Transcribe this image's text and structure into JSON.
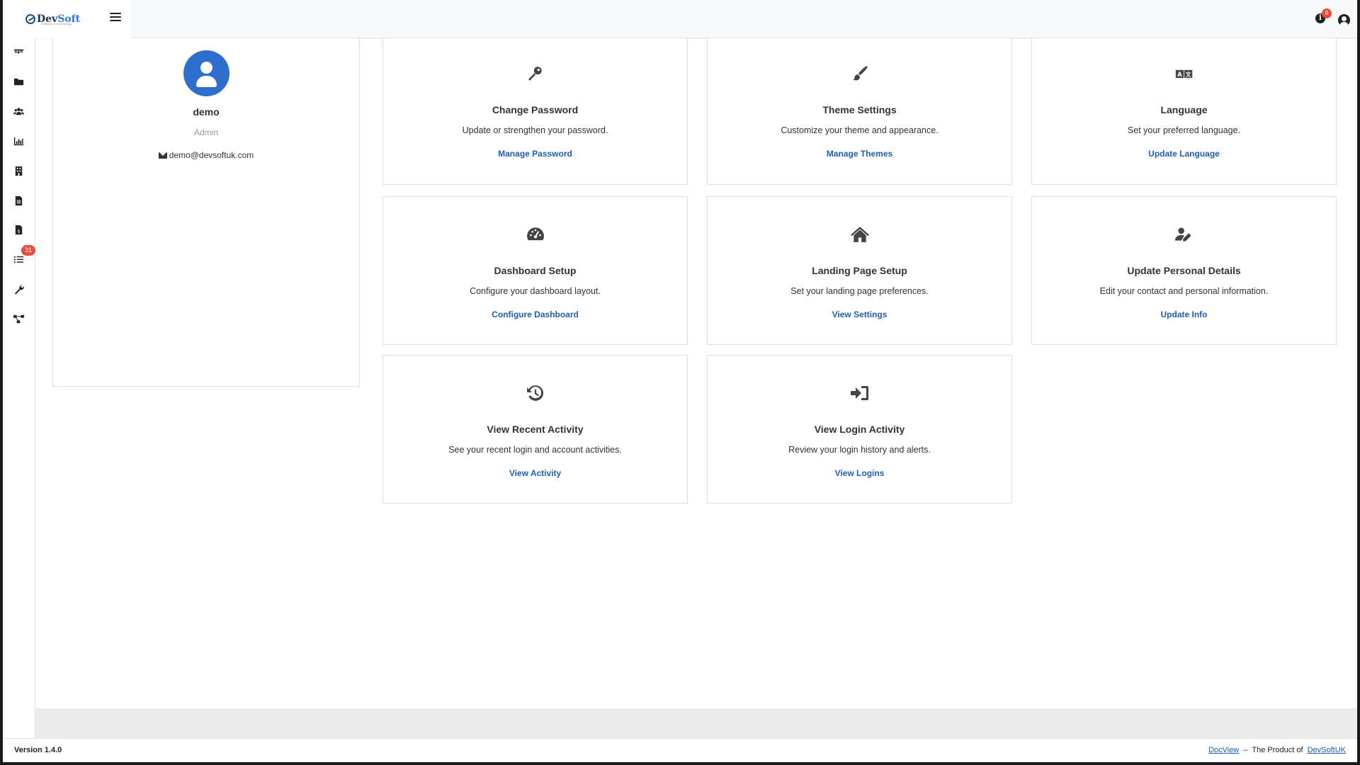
{
  "brand": {
    "name_part1": "Dev",
    "name_part2": "Soft",
    "tagline": "software & technology"
  },
  "header": {
    "notifications_badge": "8"
  },
  "sidebar": {
    "items": [
      {
        "icon": "dashboard-icon"
      },
      {
        "icon": "folder-icon"
      },
      {
        "icon": "users-icon"
      },
      {
        "icon": "chart-bar-icon"
      },
      {
        "icon": "building-icon"
      },
      {
        "icon": "document-icon"
      },
      {
        "icon": "invoice-icon"
      },
      {
        "icon": "task-list-icon",
        "badge": "31"
      },
      {
        "icon": "wrench-icon"
      },
      {
        "icon": "workflow-icon"
      }
    ]
  },
  "profile": {
    "name": "demo",
    "role": "Admin",
    "email": "demo@devsoftuk.com",
    "avatar_color": "#2d6fcc"
  },
  "cards": [
    {
      "icon": "key-icon",
      "title": "Change Password",
      "description": "Update or strengthen your password.",
      "link": "Manage Password"
    },
    {
      "icon": "paintbrush-icon",
      "title": "Theme Settings",
      "description": "Customize your theme and appearance.",
      "link": "Manage Themes"
    },
    {
      "icon": "language-icon",
      "title": "Language",
      "description": "Set your preferred language.",
      "link": "Update Language"
    },
    {
      "icon": "gauge-icon",
      "title": "Dashboard Setup",
      "description": "Configure your dashboard layout.",
      "link": "Configure Dashboard"
    },
    {
      "icon": "home-icon",
      "title": "Landing Page Setup",
      "description": "Set your landing page preferences.",
      "link": "View Settings"
    },
    {
      "icon": "user-edit-icon",
      "title": "Update Personal Details",
      "description": "Edit your contact and personal information.",
      "link": "Update Info"
    },
    {
      "icon": "history-icon",
      "title": "View Recent Activity",
      "description": "See your recent login and account activities.",
      "link": "View Activity"
    },
    {
      "icon": "sign-in-icon",
      "title": "View Login Activity",
      "description": "Review your login history and alerts.",
      "link": "View Logins"
    }
  ],
  "footer": {
    "version": "Version 1.4.0",
    "product_link": "DocView",
    "separator": "–",
    "product_of": "The Product of",
    "company_link": "DevSoftUK"
  },
  "colors": {
    "accent": "#1e5fb4",
    "badge": "#e74c3c",
    "avatar": "#2d6fcc"
  }
}
